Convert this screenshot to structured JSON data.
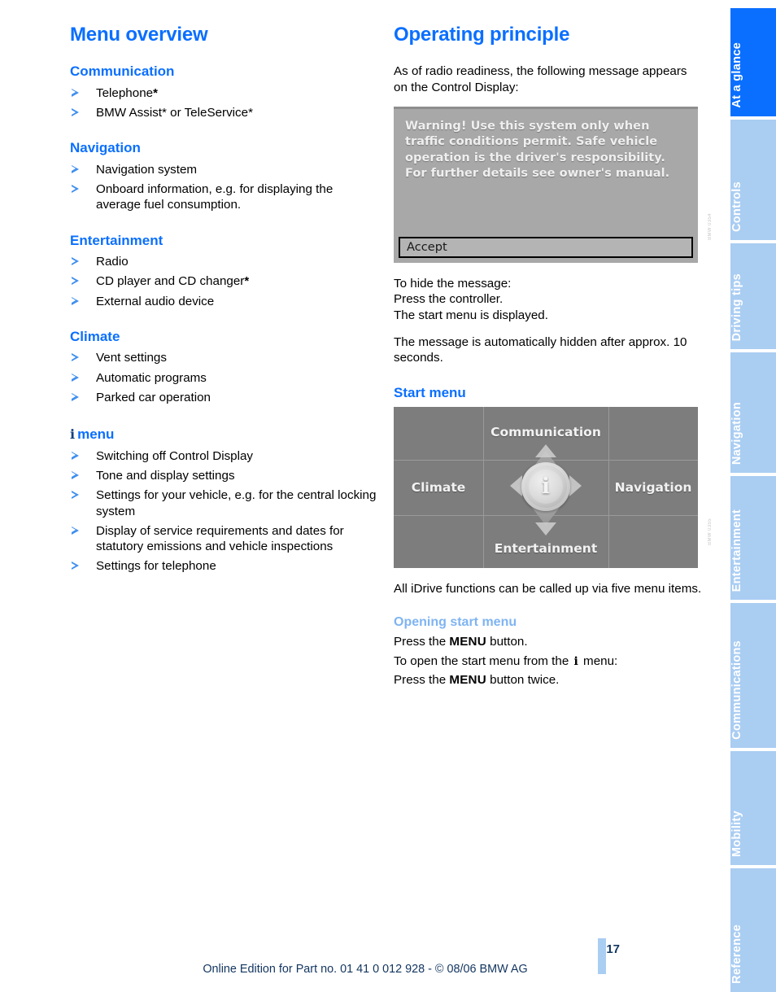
{
  "left_column": {
    "title": "Menu overview",
    "sections": [
      {
        "heading": "Communication",
        "items": [
          {
            "text": "Telephone",
            "star": "*"
          },
          {
            "text": "BMW Assist* or TeleService*",
            "star": ""
          }
        ]
      },
      {
        "heading": "Navigation",
        "items": [
          {
            "text": "Navigation system",
            "star": ""
          },
          {
            "text": "Onboard information, e.g. for displaying the average fuel consumption.",
            "star": ""
          }
        ]
      },
      {
        "heading": "Entertainment",
        "items": [
          {
            "text": "Radio",
            "star": ""
          },
          {
            "text": "CD player and CD changer",
            "star": "*"
          },
          {
            "text": "External audio device",
            "star": ""
          }
        ]
      },
      {
        "heading": "Climate",
        "items": [
          {
            "text": "Vent settings",
            "star": ""
          },
          {
            "text": "Automatic programs",
            "star": ""
          },
          {
            "text": "Parked car operation",
            "star": ""
          }
        ]
      },
      {
        "heading_icon": "i",
        "heading": "menu",
        "items": [
          {
            "text": "Switching off Control Display",
            "star": ""
          },
          {
            "text": "Tone and display settings",
            "star": ""
          },
          {
            "text": "Settings for your vehicle, e.g. for the central locking system",
            "star": ""
          },
          {
            "text": "Display of service requirements and dates for statutory emissions and vehicle inspections",
            "star": ""
          },
          {
            "text": "Settings for telephone",
            "star": ""
          }
        ]
      }
    ]
  },
  "right_column": {
    "title": "Operating principle",
    "intro": "As of radio readiness, the following message appears on the Control Display:",
    "warning_display": {
      "message": "Warning! Use this system only when traffic conditions permit. Safe vehicle operation is the driver's responsibility. For further details see owner's manual.",
      "button_label": "Accept",
      "figure_code": "BMW 0354"
    },
    "hide_message": {
      "line1": "To hide the message:",
      "line2": "Press the controller.",
      "line3": "The start menu is displayed.",
      "auto_hide": "The message is automatically hidden after approx. 10 seconds."
    },
    "start_menu_heading": "Start menu",
    "start_menu_display": {
      "top": "Communication",
      "left": "Climate",
      "right": "Navigation",
      "bottom": "Entertainment",
      "center_icon": "i",
      "figure_code": "BMW 0355"
    },
    "start_menu_note": "All iDrive functions can be called up via five menu items.",
    "opening_heading": "Opening start menu",
    "opening_steps": {
      "step1_pre": "Press the ",
      "step1_key": "MENU",
      "step1_post": " button.",
      "step2_pre": "To open the start menu from the ",
      "step2_icon": "i",
      "step2_post": " menu:",
      "step3_pre": "Press the ",
      "step3_key": "MENU",
      "step3_post": " button twice."
    }
  },
  "sidebar": {
    "tabs": [
      {
        "label": "At a glance",
        "active": true
      },
      {
        "label": "Controls",
        "active": false
      },
      {
        "label": "Driving tips",
        "active": false
      },
      {
        "label": "Navigation",
        "active": false
      },
      {
        "label": "Entertainment",
        "active": false
      },
      {
        "label": "Communications",
        "active": false
      },
      {
        "label": "Mobility",
        "active": false
      },
      {
        "label": "Reference",
        "active": false
      }
    ]
  },
  "footer": {
    "page_number": "17",
    "edition_line": "Online Edition for Part no. 01 41 0 012 928 - © 08/06 BMW AG"
  },
  "colors": {
    "accent_blue": "#0a6fff",
    "light_blue": "#7fb4f2",
    "tab_inactive": "#aacdf2",
    "footer_navy": "#12355f"
  }
}
